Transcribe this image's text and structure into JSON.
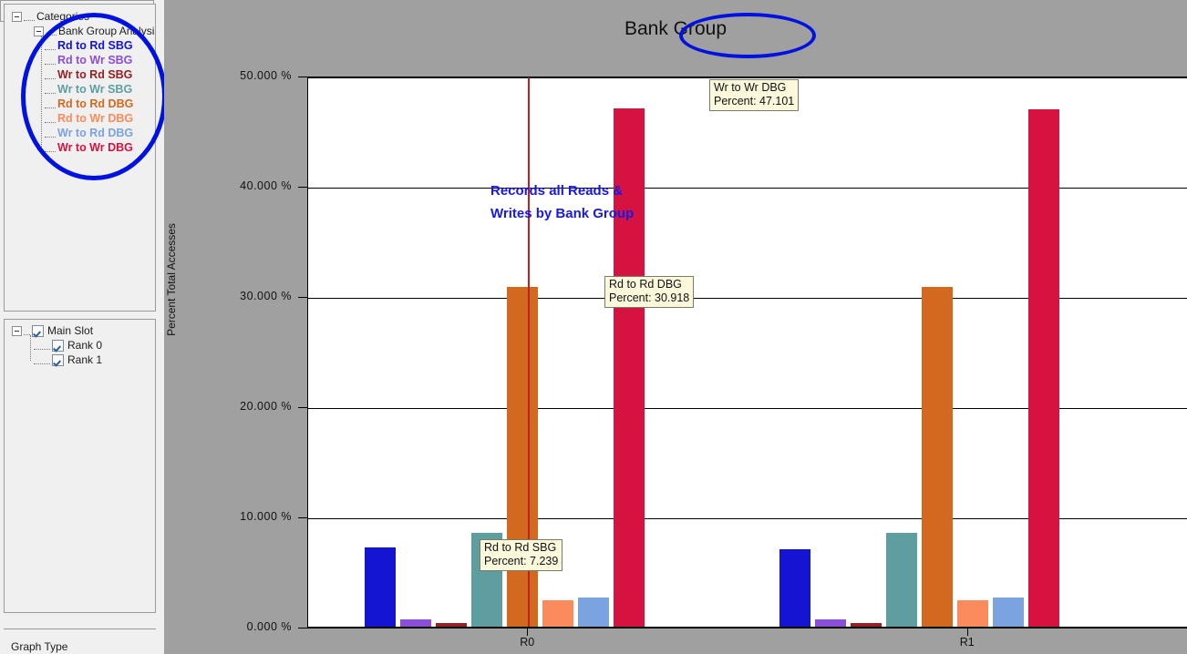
{
  "window": {
    "background_color": "#a0a0a0"
  },
  "sidebar": {
    "categories_tree": {
      "root_label": "Categories",
      "child_label": "Bank Group Analysis",
      "items": [
        {
          "label": "Rd to Rd SBG",
          "color": "#1414d2"
        },
        {
          "label": "Rd to Wr SBG",
          "color": "#8a4fd6"
        },
        {
          "label": "Wr to Rd SBG",
          "color": "#962124"
        },
        {
          "label": "Wr to Wr SBG",
          "color": "#5f9ea0"
        },
        {
          "label": "Rd to Rd DBG",
          "color": "#d2691e"
        },
        {
          "label": "Rd to Wr DBG",
          "color": "#fb8b5c"
        },
        {
          "label": "Wr to Rd DBG",
          "color": "#7aa3e0"
        },
        {
          "label": "Wr to Wr DBG",
          "color": "#d61241"
        }
      ]
    },
    "slots_tree": {
      "root_label": "Main Slot",
      "root_checked": true,
      "items": [
        {
          "label": "Rank 0",
          "checked": true
        },
        {
          "label": "Rank 1",
          "checked": true
        }
      ]
    },
    "graph_type_label": "Graph Type"
  },
  "annotations": {
    "title_highlight_color": "#0012e0",
    "note_text_line1": "Records all Reads &",
    "note_text_line2": "Writes by Bank Group",
    "note_color": "#1818e8"
  },
  "tooltips": [
    {
      "name": "Rd to Rd SBG",
      "value_label": "Percent: 7.239"
    },
    {
      "name": "Rd to Rd DBG",
      "value_label": "Percent: 30.918"
    },
    {
      "name": "Wr to Wr DBG",
      "value_label": "Percent: 47.101"
    }
  ],
  "chart_data": {
    "type": "bar",
    "title": "Bank Group",
    "xlabel": "",
    "ylabel": "Percent Total Accesses",
    "categories": [
      "R0",
      "R1"
    ],
    "ylim": [
      0,
      50
    ],
    "ytick_labels": [
      "0.000 %",
      "10.000 %",
      "20.000 %",
      "30.000 %",
      "40.000 %",
      "50.000 %"
    ],
    "ytick_values": [
      0,
      10,
      20,
      30,
      40,
      50
    ],
    "grid": true,
    "legend": "sidebar-tree",
    "series": [
      {
        "name": "Rd to Rd SBG",
        "color": "#1414d2",
        "values": [
          7.239,
          7.1
        ]
      },
      {
        "name": "Rd to Wr SBG",
        "color": "#8a4fd6",
        "values": [
          0.78,
          0.78
        ]
      },
      {
        "name": "Wr to Rd SBG",
        "color": "#962124",
        "values": [
          0.38,
          0.38
        ]
      },
      {
        "name": "Wr to Wr SBG",
        "color": "#5f9ea0",
        "values": [
          8.6,
          8.6
        ]
      },
      {
        "name": "Rd to Rd DBG",
        "color": "#d2691e",
        "values": [
          30.918,
          30.9
        ]
      },
      {
        "name": "Rd to Wr DBG",
        "color": "#fb8b5c",
        "values": [
          2.5,
          2.45
        ]
      },
      {
        "name": "Wr to Rd DBG",
        "color": "#7aa3e0",
        "values": [
          2.75,
          2.7
        ]
      },
      {
        "name": "Wr to Wr DBG",
        "color": "#d61241",
        "values": [
          47.101,
          47.0
        ]
      }
    ],
    "marker_line": {
      "category": "R0",
      "color": "#c02020"
    }
  }
}
